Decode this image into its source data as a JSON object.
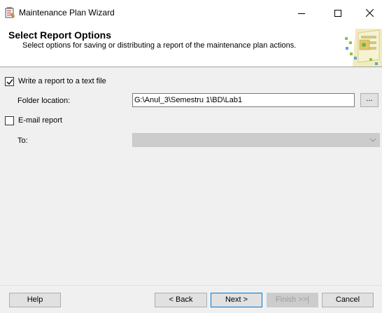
{
  "window": {
    "title": "Maintenance Plan Wizard"
  },
  "header": {
    "title": "Select Report Options",
    "subtitle": "Select options for saving or distributing a report of the maintenance plan actions."
  },
  "options": {
    "write_report": {
      "label": "Write a report to a text file",
      "checked": true
    },
    "folder_location": {
      "label": "Folder location:",
      "value": "G:\\Anul_3\\Semestru 1\\BD\\Lab1",
      "browse_label": "..."
    },
    "email_report": {
      "label": "E-mail report",
      "checked": false
    },
    "to": {
      "label": "To:",
      "value": ""
    }
  },
  "footer": {
    "help_label": "Help",
    "back_label": "< Back",
    "next_label": "Next >",
    "finish_label": "Finish >>|",
    "cancel_label": "Cancel"
  },
  "colors": {
    "accent": "#0078d7",
    "disabled_bg": "#cccccc"
  },
  "icons": {
    "app": "wizard-app-icon",
    "minimize": "minimize-icon",
    "maximize": "maximize-icon",
    "close": "close-icon",
    "checkmark": "checkmark-icon",
    "dropdown": "chevron-down-icon"
  }
}
